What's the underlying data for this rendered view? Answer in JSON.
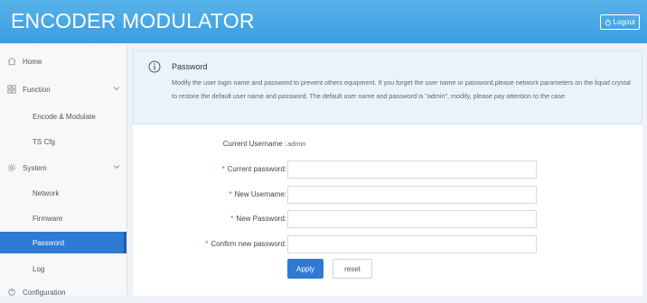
{
  "header": {
    "title": "ENCODER MODULATOR",
    "logout_label": "Logout"
  },
  "sidebar": {
    "items": [
      {
        "label": "Home",
        "icon": "home-icon"
      },
      {
        "label": "Function",
        "icon": "grid-icon"
      },
      {
        "label": "Encode & Modulate"
      },
      {
        "label": "TS Cfg"
      },
      {
        "label": "System",
        "icon": "gear-icon"
      },
      {
        "label": "Network"
      },
      {
        "label": "Firmware"
      },
      {
        "label": "Password"
      },
      {
        "label": "Log"
      },
      {
        "label": "Configuration",
        "icon": "config-icon"
      }
    ]
  },
  "notice": {
    "title": "Password",
    "body": "Modify the user login name and password to prevent others equipment. If you forget the user name or password,please network parameters on the liquid crystal to restore the default user name and password. The default user name and password is \"admin\", modify, please pay attention to the case"
  },
  "form": {
    "current_username_label": "Current Username :",
    "current_username_value": "admin",
    "current_password_label": "Current password:",
    "new_username_label": "New Username:",
    "new_password_label": "New Password:",
    "confirm_password_label": "Confirm new password:",
    "required_mark": "*",
    "apply_label": "Apply",
    "reset_label": "reset"
  },
  "colors": {
    "header": "#3a9ee0",
    "active_nav": "#2d7bd5",
    "notice_bg": "#e8f3fc",
    "required": "#e04040"
  }
}
